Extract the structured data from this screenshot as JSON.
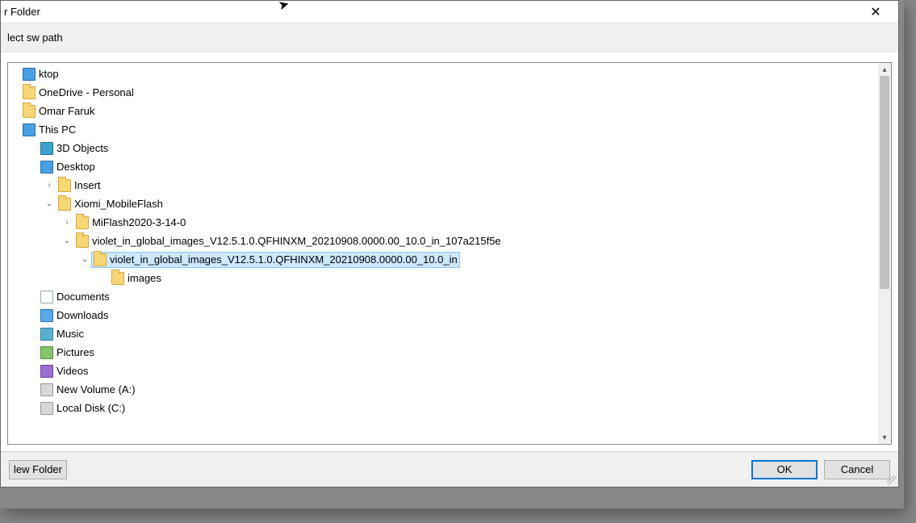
{
  "dialog": {
    "title": "r Folder",
    "subtitle": "lect sw path"
  },
  "tree": [
    {
      "indent": 0,
      "exp": "none",
      "icon": "monitor",
      "label": "ktop",
      "sel": false,
      "name": "tree-desktop-root"
    },
    {
      "indent": 0,
      "exp": "none",
      "icon": "folder",
      "label": "OneDrive - Personal",
      "sel": false,
      "name": "tree-onedrive"
    },
    {
      "indent": 0,
      "exp": "none",
      "icon": "folder",
      "label": "Omar Faruk",
      "sel": false,
      "name": "tree-user"
    },
    {
      "indent": 0,
      "exp": "none",
      "icon": "monitor",
      "label": "This PC",
      "sel": false,
      "name": "tree-this-pc"
    },
    {
      "indent": 1,
      "exp": "none",
      "icon": "objects3d",
      "label": "3D Objects",
      "sel": false,
      "name": "tree-3d-objects"
    },
    {
      "indent": 1,
      "exp": "none",
      "icon": "monitor",
      "label": "Desktop",
      "sel": false,
      "name": "tree-desktop"
    },
    {
      "indent": 2,
      "exp": "closed",
      "icon": "folder",
      "label": "Insert",
      "sel": false,
      "name": "tree-insert"
    },
    {
      "indent": 2,
      "exp": "open",
      "icon": "folder",
      "label": "Xiomi_MobileFlash",
      "sel": false,
      "name": "tree-xiomi"
    },
    {
      "indent": 3,
      "exp": "closed",
      "icon": "folder",
      "label": "MiFlash2020-3-14-0",
      "sel": false,
      "name": "tree-miflash"
    },
    {
      "indent": 3,
      "exp": "open",
      "icon": "folder",
      "label": "violet_in_global_images_V12.5.1.0.QFHINXM_20210908.0000.00_10.0_in_107a215f5e",
      "sel": false,
      "name": "tree-violet-outer"
    },
    {
      "indent": 4,
      "exp": "open",
      "icon": "folder",
      "label": "violet_in_global_images_V12.5.1.0.QFHINXM_20210908.0000.00_10.0_in",
      "sel": true,
      "name": "tree-violet-inner"
    },
    {
      "indent": 5,
      "exp": "none",
      "icon": "folder",
      "label": "images",
      "sel": false,
      "name": "tree-images"
    },
    {
      "indent": 1,
      "exp": "none",
      "icon": "docs",
      "label": "Documents",
      "sel": false,
      "name": "tree-documents"
    },
    {
      "indent": 1,
      "exp": "none",
      "icon": "downloads",
      "label": "Downloads",
      "sel": false,
      "name": "tree-downloads"
    },
    {
      "indent": 1,
      "exp": "none",
      "icon": "music",
      "label": "Music",
      "sel": false,
      "name": "tree-music"
    },
    {
      "indent": 1,
      "exp": "none",
      "icon": "pictures",
      "label": "Pictures",
      "sel": false,
      "name": "tree-pictures"
    },
    {
      "indent": 1,
      "exp": "none",
      "icon": "videos",
      "label": "Videos",
      "sel": false,
      "name": "tree-videos"
    },
    {
      "indent": 1,
      "exp": "none",
      "icon": "drive",
      "label": "New Volume (A:)",
      "sel": false,
      "name": "tree-vol-a"
    },
    {
      "indent": 1,
      "exp": "none",
      "icon": "drive",
      "label": "Local Disk (C:)",
      "sel": false,
      "name": "tree-vol-c"
    }
  ],
  "footer": {
    "newFolder": "lew Folder",
    "ok": "OK",
    "cancel": "Cancel"
  }
}
